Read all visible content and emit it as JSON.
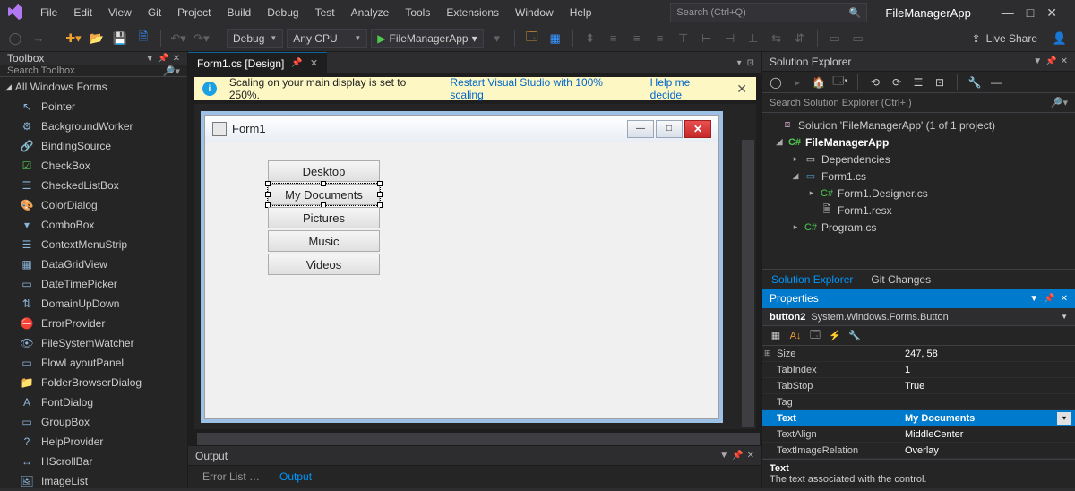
{
  "menubar": [
    "File",
    "Edit",
    "View",
    "Git",
    "Project",
    "Build",
    "Debug",
    "Test",
    "Analyze",
    "Tools",
    "Extensions",
    "Window",
    "Help"
  ],
  "searchPlaceholder": "Search (Ctrl+Q)",
  "appTitle": "FileManagerApp",
  "toolbar": {
    "config": "Debug",
    "platform": "Any CPU",
    "startTarget": "FileManagerApp",
    "liveShare": "Live Share"
  },
  "toolbox": {
    "title": "Toolbox",
    "searchPlaceholder": "Search Toolbox",
    "group": "All Windows Forms",
    "items": [
      "Pointer",
      "BackgroundWorker",
      "BindingSource",
      "CheckBox",
      "CheckedListBox",
      "ColorDialog",
      "ComboBox",
      "ContextMenuStrip",
      "DataGridView",
      "DateTimePicker",
      "DomainUpDown",
      "ErrorProvider",
      "FileSystemWatcher",
      "FlowLayoutPanel",
      "FolderBrowserDialog",
      "FontDialog",
      "GroupBox",
      "HelpProvider",
      "HScrollBar",
      "ImageList"
    ]
  },
  "docTab": {
    "label": "Form1.cs [Design]"
  },
  "infoBar": {
    "msg": "Scaling on your main display is set to 250%.",
    "link1": "Restart Visual Studio with 100% scaling",
    "link2": "Help me decide"
  },
  "designer": {
    "formTitle": "Form1",
    "buttons": [
      "Desktop",
      "My Documents",
      "Pictures",
      "Music",
      "Videos"
    ],
    "selectedIndex": 1
  },
  "output": {
    "title": "Output",
    "tabs": [
      "Error List …",
      "Output"
    ],
    "activeTab": 1
  },
  "solutionExplorer": {
    "title": "Solution Explorer",
    "searchPlaceholder": "Search Solution Explorer (Ctrl+;)",
    "solution": "Solution 'FileManagerApp' (1 of 1 project)",
    "project": "FileManagerApp",
    "nodes": {
      "deps": "Dependencies",
      "form": "Form1.cs",
      "designer": "Form1.Designer.cs",
      "resx": "Form1.resx",
      "program": "Program.cs"
    },
    "secTabs": [
      "Solution Explorer",
      "Git Changes"
    ]
  },
  "properties": {
    "title": "Properties",
    "objectName": "button2",
    "objectType": "System.Windows.Forms.Button",
    "rows": [
      {
        "name": "Size",
        "val": "247, 58",
        "exp": true
      },
      {
        "name": "TabIndex",
        "val": "1"
      },
      {
        "name": "TabStop",
        "val": "True"
      },
      {
        "name": "Tag",
        "val": ""
      },
      {
        "name": "Text",
        "val": "My Documents",
        "sel": true
      },
      {
        "name": "TextAlign",
        "val": "MiddleCenter"
      },
      {
        "name": "TextImageRelation",
        "val": "Overlay"
      }
    ],
    "descTitle": "Text",
    "descBody": "The text associated with the control."
  }
}
